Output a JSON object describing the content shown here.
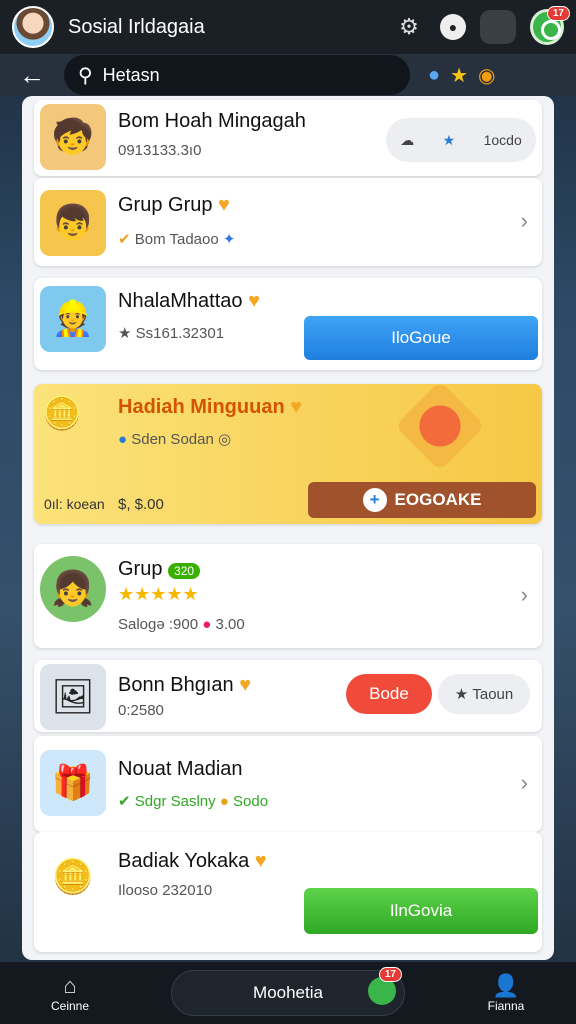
{
  "header": {
    "title": "Sosial Irldagaia",
    "badge_count": "17"
  },
  "search": {
    "placeholder": "Hetasn"
  },
  "items": [
    {
      "name": "Bom Hoah Mingagah",
      "sub": "0913133.3ı0",
      "pill_label": "1ocdo"
    },
    {
      "name": "Grup Grup",
      "sub": "Bom Tadaoo"
    },
    {
      "name": "NhalaMhattao",
      "sub": "Ss161.32301",
      "button": "IloGoue"
    },
    {
      "name": "Hadiah Minguuan",
      "sub": "Sden Sodan",
      "left_bottom": "0ıl: koean",
      "price": "$, $.00",
      "banner_button": "EOGOAKE"
    },
    {
      "name": "Grup",
      "tag": "320",
      "stars": "★★★★★",
      "sub": "Salogə :900",
      "price": "3.00"
    },
    {
      "name": "Bonn Bhgıan",
      "sub": "0:2580",
      "btn_red": "Bode",
      "btn_gray": "Taoun"
    },
    {
      "name": "Nouat Madian",
      "sub": "Sdgr Saslny",
      "sub2": "Sodo"
    },
    {
      "name": "Badiak Yokaka",
      "sub": "Ilooso 232010",
      "button": "IlnGovia"
    }
  ],
  "bottom_nav": {
    "left_label": "Ceinne",
    "center_label": "Moohetia",
    "right_label": "Fianna",
    "badge": "17"
  }
}
